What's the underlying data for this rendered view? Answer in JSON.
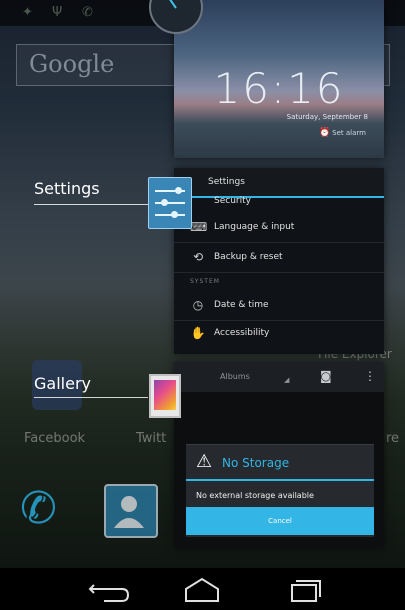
{
  "homescreen": {
    "search_logo": "Google",
    "apps": [
      {
        "label": "Facebook"
      },
      {
        "label": "Twitt"
      },
      {
        "label": "File Explorer"
      },
      {
        "label": "re"
      }
    ]
  },
  "recents": {
    "clock_card": {
      "time": "16:16",
      "date": "Saturday, September 8",
      "alarm": "Set alarm"
    },
    "settings_task": {
      "label": "Settings",
      "title": "Settings",
      "section_header": "SYSTEM",
      "items": [
        {
          "label": "Security",
          "icon": "lock-icon"
        },
        {
          "label": "Language & input",
          "icon": "keyboard-icon"
        },
        {
          "label": "Backup & reset",
          "icon": "backup-icon"
        },
        {
          "label": "Date & time",
          "icon": "clock-icon"
        },
        {
          "label": "Accessibility",
          "icon": "hand-icon"
        }
      ]
    },
    "gallery_task": {
      "label": "Gallery",
      "albums_label": "Albums",
      "dialog": {
        "title": "No Storage",
        "message": "No external storage available",
        "button": "Cancel"
      }
    }
  },
  "colors": {
    "accent": "#33b5e5",
    "background": "#000000"
  }
}
